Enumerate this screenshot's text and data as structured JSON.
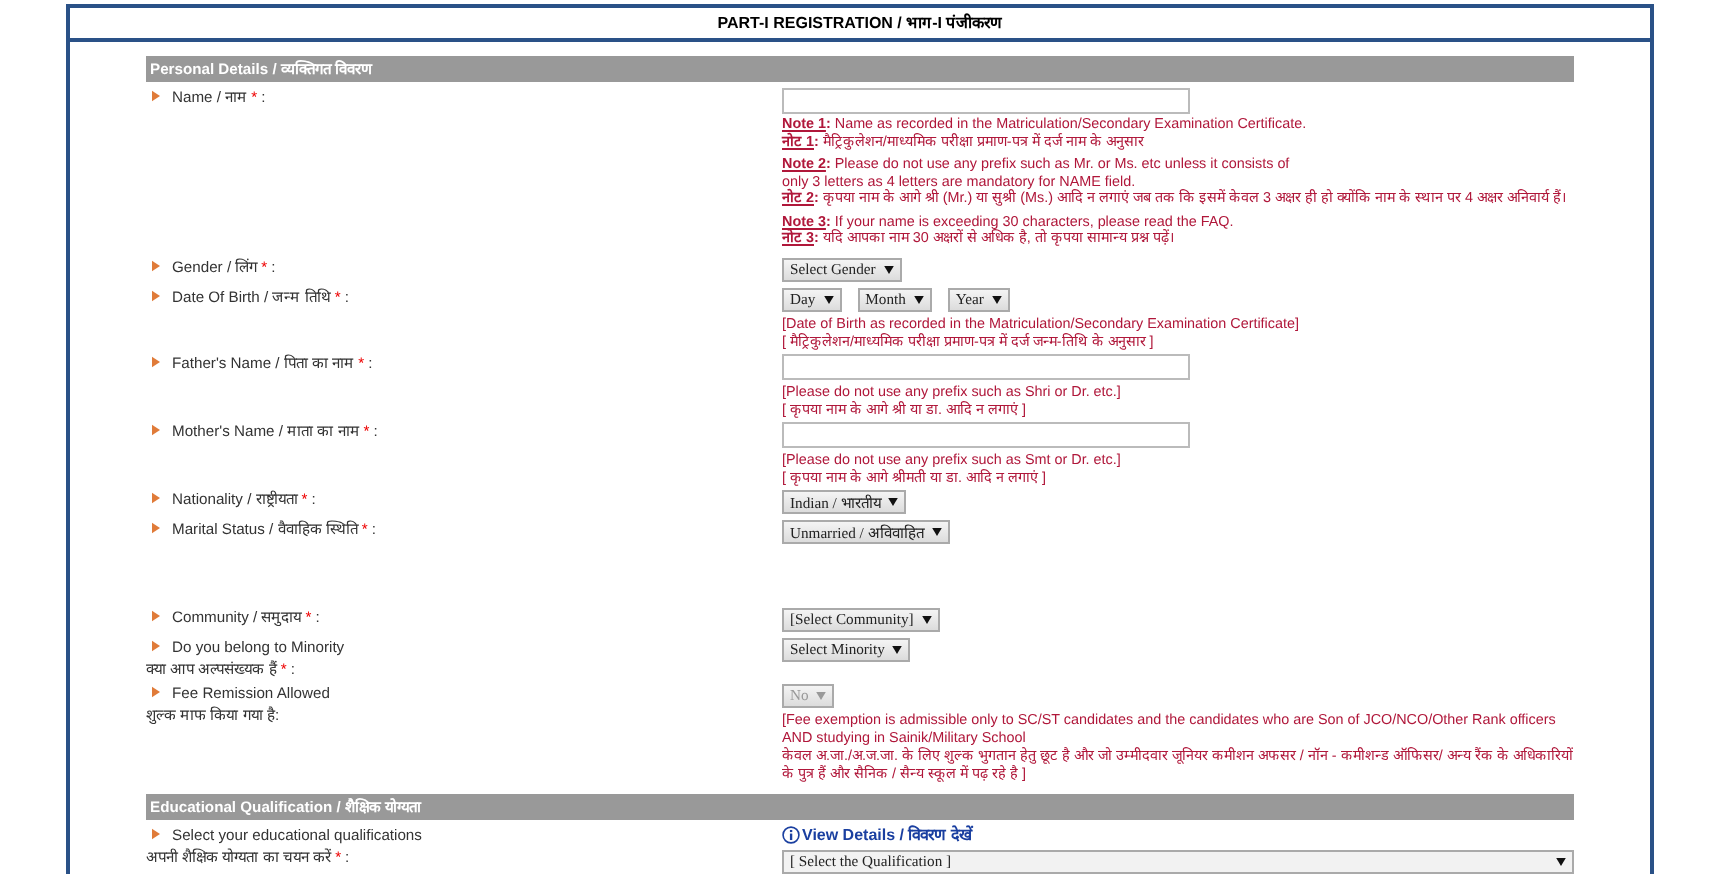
{
  "title": "PART-I REGISTRATION / भाग-I पंजीकरण",
  "sections": [
    {
      "heading": "Personal Details / व्यक्तिगत विवरण",
      "fields": [
        {
          "label": [
            "Name / नाम"
          ],
          "required_mark": "*",
          "colon": ":",
          "control": {
            "kind": "text"
          },
          "notes": [
            [
              {
                "tag": "Note 1",
                "sep": ":",
                "text": [
                  "Name as recorded in the Matriculation/Secondary Examination Certificate."
                ]
              },
              {
                "tag": "नोट 1",
                "sep": ":",
                "text": [
                  "मैट्रिकुलेशन/माध्यमिक परीक्षा प्रमाण-पत्र में दर्ज नाम के अनुसार"
                ]
              }
            ],
            [
              {
                "tag": "Note 2",
                "sep": ":",
                "text": [
                  "Please do not use any prefix such as Mr. or Ms. etc unless it consists of",
                  "only 3 letters as 4 letters are mandatory for NAME field."
                ]
              },
              {
                "tag": "नोट 2",
                "sep": ":",
                "text": [
                  "कृपया नाम के आगे श्री (Mr.) या सुश्री (Ms.) आदि न लगाएं जब तक कि इसमें केवल 3 अक्षर ही हो क्योंकि नाम के स्थान पर 4 अक्षर अनिवार्य हैं।"
                ]
              }
            ],
            [
              {
                "tag": "Note 3",
                "sep": ":",
                "text": [
                  "If your name is exceeding 30 characters, please read the FAQ."
                ]
              },
              {
                "tag": "नोट 3",
                "sep": ":",
                "text": [
                  "यदि आपका नाम 30 अक्षरों से अधिक है, तो कृपया सामान्य प्रश्न पढ़ें।"
                ]
              }
            ]
          ]
        },
        {
          "label": [
            "Gender / लिंग"
          ],
          "required_mark": "*",
          "colon": ":",
          "control": {
            "kind": "select",
            "options": [
              {
                "value": "Select Gender",
                "disabled": false
              }
            ]
          }
        },
        {
          "label": [
            "Date Of Birth / जन्म तिथि"
          ],
          "required_mark": "*",
          "colon": ":",
          "control": {
            "kind": "select",
            "options": [
              {
                "value": "Day",
                "disabled": false
              },
              {
                "value": "Month",
                "disabled": false
              },
              {
                "value": "Year",
                "disabled": false
              }
            ]
          },
          "hints": [
            "[Date of Birth as recorded in the Matriculation/Secondary Examination Certificate]",
            "[ मैट्रिकुलेशन/माध्यमिक परीक्षा प्रमाण-पत्र में दर्ज जन्म-तिथि के अनुसार ]"
          ]
        },
        {
          "label": [
            "Father's Name / पिता का नाम"
          ],
          "required_mark": "*",
          "colon": ":",
          "control": {
            "kind": "text"
          },
          "hints": [
            "[Please do not use any prefix such as Shri or Dr. etc.]",
            "[ कृपया नाम के आगे श्री या डा. आदि न लगाएं ]"
          ]
        },
        {
          "label": [
            "Mother's Name / माता का नाम"
          ],
          "required_mark": "*",
          "colon": ":",
          "control": {
            "kind": "text"
          },
          "hints": [
            "[Please do not use any prefix such as Smt or Dr. etc.]",
            "[ कृपया नाम के आगे श्रीमती या डा. आदि न लगाएं ]"
          ]
        },
        {
          "label": [
            "Nationality / राष्ट्रीयता"
          ],
          "required_mark": "*",
          "colon": ":",
          "control": {
            "kind": "select",
            "options": [
              {
                "value": "Indian / भारतीय",
                "disabled": false
              }
            ]
          }
        },
        {
          "label": [
            "Marital Status / वैवाहिक स्थिति"
          ],
          "required_mark": "*",
          "colon": ":",
          "control": {
            "kind": "select",
            "options": [
              {
                "value": "Unmarried / अविवाहित",
                "disabled": false
              }
            ]
          }
        },
        {
          "label": [
            "Community / समुदाय"
          ],
          "required_mark": "*",
          "colon": ":",
          "control": {
            "kind": "select",
            "options": [
              {
                "value": "[Select Community]",
                "disabled": false
              }
            ]
          }
        },
        {
          "label": [
            "Do you belong to Minority",
            "क्या आप अल्पसंख्यक हैं"
          ],
          "required_mark": "*",
          "colon": ":",
          "control": {
            "kind": "select",
            "options": [
              {
                "value": "Select Minority",
                "disabled": false
              }
            ]
          }
        },
        {
          "label": [
            "Fee Remission Allowed",
            "शुल्क माफ किया गया है:"
          ],
          "control": {
            "kind": "select",
            "options": [
              {
                "value": "No",
                "disabled": true
              }
            ]
          },
          "hints": [
            "[Fee exemption is admissible only to SC/ST candidates and the candidates who are Son of JCO/NCO/Other Rank officers AND studying in Sainik/Military School",
            "केवल अ.जा./अ.ज.जा. के लिए शुल्क भुगतान हेतु छूट है और जो उम्मीदवार जूनियर कमीशन अफसर / नॉन - कमीशन्ड ऑफिसर/ अन्य रैंक के अधिकारियों के पुत्र हैं और सैनिक / सैन्य स्कूल में पढ़ रहे है ]"
          ]
        }
      ]
    },
    {
      "heading": "Educational Qualification / शैक्षिक योग्यता",
      "fields": [
        {
          "label": [
            "Select your educational qualifications",
            "अपनी शैक्षिक योग्यता का चयन करें"
          ],
          "required_mark": "*",
          "colon": ":",
          "link": "View Details / विवरण देखें",
          "control": {
            "kind": "wide-select",
            "options": [
              {
                "value": "[ Select the Qualification ]",
                "disabled": false
              }
            ]
          }
        }
      ]
    }
  ]
}
